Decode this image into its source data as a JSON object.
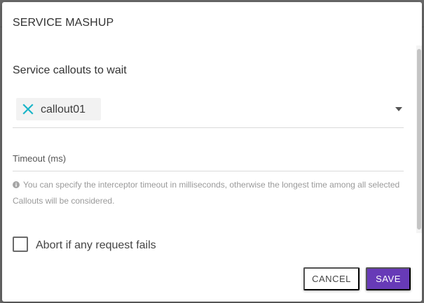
{
  "dialog": {
    "title": "SERVICE MASHUP"
  },
  "callouts": {
    "section_label": "Service callouts to wait",
    "selected_chip": "callout01",
    "chip_remove_icon": "close-icon",
    "dropdown_icon": "caret-down-icon"
  },
  "timeout": {
    "placeholder": "Timeout (ms)",
    "value": "",
    "help_icon": "info-icon",
    "help_text": "You can specify the interceptor timeout in milliseconds, otherwise the longest time among all selected Callouts will be considered."
  },
  "abort": {
    "label": "Abort if any request fails",
    "checked": false
  },
  "actions": {
    "cancel_label": "CANCEL",
    "save_label": "SAVE"
  },
  "colors": {
    "accent": "#673ab7",
    "chip_icon": "#1bb5c8"
  }
}
